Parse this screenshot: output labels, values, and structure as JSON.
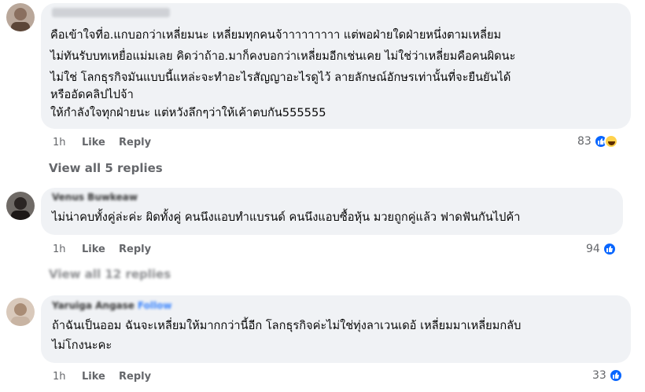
{
  "comments": [
    {
      "author": "",
      "text_lines": [
        "คือเข้าใจที่อ.แกบอกว่าเหลี่ยมนะ เหลี่ยมทุกคนจ้าาาาาาาาา แต่พอฝ่ายใดฝ่ายหนึ่งตามเหลี่ยม",
        "ไม่ทันรับบทเหยื่อแม่มเลย คิดว่าถ้าอ.มาก็คงบอกว่าเหลี่ยมอีกเช่นเคย ไม่ใช่ว่าเหลี่ยมคือคนผิดนะ",
        "ไม่ใช่ โลกธุรกิจมันแบบนี้แหล่ะจะทำอะไรสัญญาอะไรดูไว้ ลายลักษณ์อักษรเท่านั้นที่จะยืนยันได้",
        "หรืออัดคลิปไปจ้า",
        "ให้กำลังใจทุกฝ่ายนะ แต่หวังลึกๆว่าให้เค้าตบกัน555555"
      ],
      "time": "1h",
      "like_label": "Like",
      "reply_label": "Reply",
      "reaction_count": "83",
      "reactions": [
        "like-icon",
        "haha-icon"
      ],
      "view_replies": "View all 5 replies"
    },
    {
      "author": "Venus Buwkeaw",
      "text_lines": [
        "ไม่น่าคบทั้งคู่ล่ะค่ะ ผิดทั้งคู่ คนนึงแอบทำแบรนด์ คนนึงแอบซื้อหุ้น มวยถูกคู่แล้ว ฟาดฟันกันไปค้า"
      ],
      "time": "1h",
      "like_label": "Like",
      "reply_label": "Reply",
      "reaction_count": "94",
      "reactions": [
        "like-icon"
      ],
      "view_replies": "View all 12 replies"
    },
    {
      "author": "Yaruiga Angase",
      "follow_label": "Follow",
      "text_lines": [
        "ถ้าฉันเป็นออม ฉันจะเหลี่ยมให้มากกว่านี้อีก โลกธุรกิจค่ะไม่ใช่ทุ่งลาเวนเดอ้ เหลี่ยมมาเหลี่ยมกลับ",
        "ไม่โกงนะคะ"
      ],
      "time": "1h",
      "like_label": "Like",
      "reply_label": "Reply",
      "reaction_count": "33",
      "reactions": [
        "like-icon"
      ]
    }
  ],
  "colors": {
    "bubble": "#f0f2f5",
    "meta_text": "#65676b",
    "like_blue": "#0866ff",
    "haha_yellow": "#ffd24c"
  }
}
